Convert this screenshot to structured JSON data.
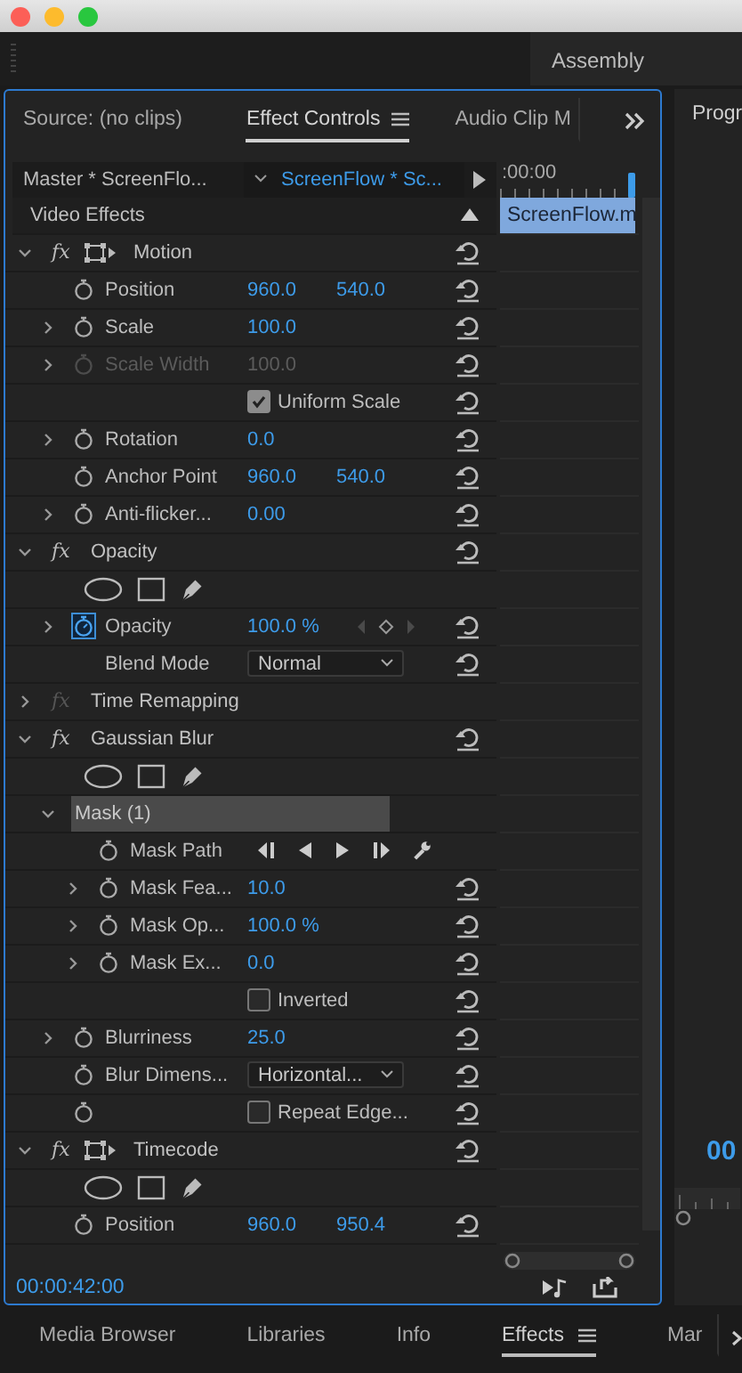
{
  "workspace_bar": {
    "workspace": "Assembly"
  },
  "effect_panel": {
    "tabs": [
      {
        "label": "Source: (no clips)",
        "selected": false,
        "menu": false
      },
      {
        "label": "Effect Controls",
        "selected": true,
        "menu": true
      },
      {
        "label": "Audio Clip M",
        "selected": false,
        "menu": false
      }
    ],
    "master_clip": "Master * ScreenFlo...",
    "sequence_clip": "ScreenFlow * Sc...",
    "section": "Video Effects",
    "effects": [
      {
        "fx": "fx",
        "name": "Motion",
        "expanded": true,
        "fx_enabled": true,
        "transform_icon": true,
        "resettable": true,
        "children": [
          {
            "kind": "param",
            "label": "Position",
            "expandable": false,
            "values": [
              "960.0",
              "540.0"
            ]
          },
          {
            "kind": "param",
            "label": "Scale",
            "expandable": true,
            "values": [
              "100.0"
            ]
          },
          {
            "kind": "param",
            "label": "Scale Width",
            "expandable": true,
            "values": [
              "100.0"
            ],
            "disabled": true
          },
          {
            "kind": "checkbox",
            "label": "Uniform Scale",
            "checked": true,
            "stopwatch": false
          },
          {
            "kind": "param",
            "label": "Rotation",
            "expandable": true,
            "values": [
              "0.0"
            ]
          },
          {
            "kind": "param",
            "label": "Anchor Point",
            "expandable": false,
            "values": [
              "960.0",
              "540.0"
            ]
          },
          {
            "kind": "param",
            "label": "Anti-flicker...",
            "expandable": true,
            "values": [
              "0.00"
            ]
          }
        ]
      },
      {
        "fx": "fx",
        "name": "Opacity",
        "expanded": true,
        "fx_enabled": true,
        "transform_icon": false,
        "resettable": true,
        "children": [
          {
            "kind": "mask_tools"
          },
          {
            "kind": "param",
            "label": "Opacity",
            "expandable": true,
            "values": [
              "100.0 %"
            ],
            "animated": true,
            "keyframe_nav": true
          },
          {
            "kind": "dropdown",
            "label": "Blend Mode",
            "value": "Normal",
            "stopwatch": false
          }
        ]
      },
      {
        "fx": "fx",
        "name": "Time Remapping",
        "expanded": false,
        "fx_enabled": false,
        "transform_icon": false,
        "resettable": false
      },
      {
        "fx": "fx",
        "name": "Gaussian Blur",
        "expanded": true,
        "fx_enabled": true,
        "transform_icon": false,
        "resettable": true,
        "children": [
          {
            "kind": "mask_tools"
          },
          {
            "kind": "mask",
            "label": "Mask (1)",
            "expanded": true,
            "selected": true,
            "children": [
              {
                "kind": "mask_path",
                "label": "Mask Path"
              },
              {
                "kind": "param",
                "label": "Mask Fea...",
                "expandable": true,
                "values": [
                  "10.0"
                ]
              },
              {
                "kind": "param",
                "label": "Mask Op...",
                "expandable": true,
                "values": [
                  "100.0 %"
                ]
              },
              {
                "kind": "param",
                "label": "Mask Ex...",
                "expandable": true,
                "values": [
                  "0.0"
                ]
              },
              {
                "kind": "checkbox",
                "label": "Inverted",
                "checked": false,
                "stopwatch": false
              }
            ]
          },
          {
            "kind": "param",
            "label": "Blurriness",
            "expandable": true,
            "values": [
              "25.0"
            ]
          },
          {
            "kind": "dropdown",
            "label": "Blur Dimens...",
            "value": "Horizontal...",
            "stopwatch": true
          },
          {
            "kind": "checkbox",
            "label": "Repeat Edge...",
            "checked": false,
            "stopwatch": true
          }
        ]
      },
      {
        "fx": "fx",
        "name": "Timecode",
        "expanded": true,
        "fx_enabled": true,
        "transform_icon": true,
        "resettable": true,
        "children": [
          {
            "kind": "mask_tools"
          },
          {
            "kind": "param",
            "label": "Position",
            "expandable": false,
            "values": [
              "960.0",
              "950.4"
            ]
          }
        ]
      }
    ],
    "timeline": {
      "ruler_time": ":00:00",
      "clip": "ScreenFlow.m"
    },
    "current_time": "00:00:42:00"
  },
  "program_panel": {
    "title": "Progr",
    "timecode": "00"
  },
  "bottom_panel": {
    "tabs": [
      {
        "label": "Media Browser",
        "selected": false,
        "menu": false
      },
      {
        "label": "Libraries",
        "selected": false,
        "menu": false
      },
      {
        "label": "Info",
        "selected": false,
        "menu": false
      },
      {
        "label": "Effects",
        "selected": true,
        "menu": true
      },
      {
        "label": "Mar",
        "selected": false,
        "menu": false
      }
    ]
  }
}
